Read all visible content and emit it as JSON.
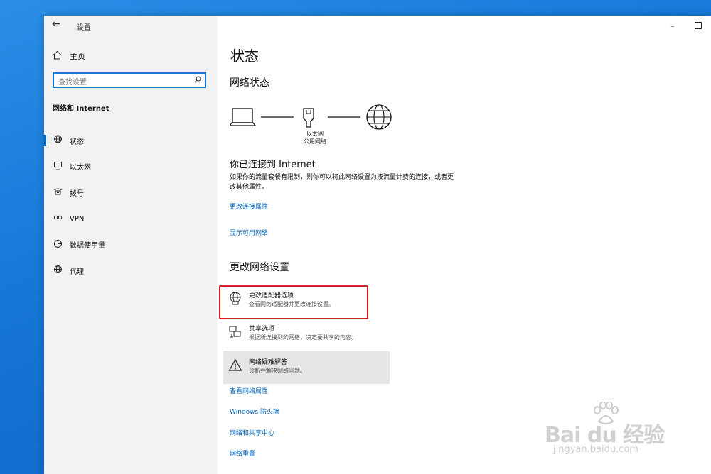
{
  "window": {
    "title": "设置",
    "controls": {
      "minimize": "–",
      "maximize": "□"
    }
  },
  "sidebar": {
    "home": "主页",
    "search_placeholder": "查找设置",
    "section": "网络和 Internet",
    "items": [
      {
        "label": "状态",
        "icon": "status-icon",
        "active": true
      },
      {
        "label": "以太网",
        "icon": "ethernet-icon"
      },
      {
        "label": "拨号",
        "icon": "dialup-icon"
      },
      {
        "label": "VPN",
        "icon": "vpn-icon"
      },
      {
        "label": "数据使用量",
        "icon": "data-usage-icon"
      },
      {
        "label": "代理",
        "icon": "proxy-icon"
      }
    ]
  },
  "main": {
    "page_title": "状态",
    "network_status_heading": "网络状态",
    "diagram": {
      "adapter_label": "以太网",
      "network_type": "公用网络"
    },
    "connected_title": "你已连接到 Internet",
    "connected_desc": "如果你的流量套餐有限制，则你可以将此网络设置为按流量计费的连接，或者更改其他属性。",
    "links_top": [
      "更改连接属性",
      "显示可用网络"
    ],
    "change_heading": "更改网络设置",
    "options": [
      {
        "title": "更改适配器选项",
        "subtitle": "查看网络适配器并更改连接设置。",
        "icon": "adapter-globe-icon"
      },
      {
        "title": "共享选项",
        "subtitle": "根据所连接到的网络，决定要共享的内容。",
        "icon": "sharing-icon"
      },
      {
        "title": "网络疑难解答",
        "subtitle": "诊断并解决网络问题。",
        "icon": "warning-icon"
      }
    ],
    "links_bottom": [
      "查看网络属性",
      "Windows 防火墙",
      "网络和共享中心",
      "网络重置"
    ]
  },
  "watermark": {
    "brand": "Bai du 经验",
    "url": "jingyan.baidu.com"
  },
  "colors": {
    "accent": "#0067c0",
    "highlight": "#d62222",
    "sidebar_bg": "#f2f2f2"
  }
}
